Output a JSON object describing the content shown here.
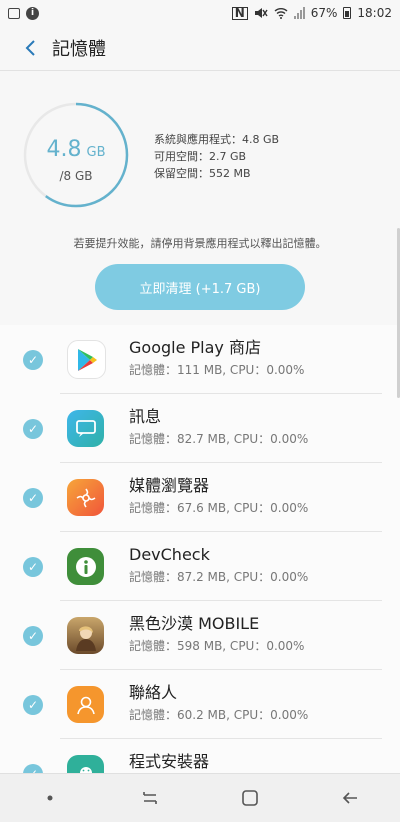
{
  "status_bar": {
    "battery": "67%",
    "time": "18:02",
    "nfc_label": "N"
  },
  "header": {
    "title": "記憶體",
    "back_icon": "chevron-left-icon"
  },
  "summary": {
    "used_value": "4.8",
    "used_unit": "GB",
    "total": "/8 GB",
    "used_fraction": 0.6,
    "stats": [
      "系統與應用程式：4.8 GB",
      "可用空間：2.7 GB",
      "保留空間：552 MB"
    ],
    "hint": "若要提升效能，請停用背景應用程式以釋出記憶體。",
    "clean_button": "立即清理 (+1.7 GB)"
  },
  "apps": [
    {
      "name": "Google Play 商店",
      "detail": "記憶體：111 MB, CPU：0.00%",
      "icon": "google-play-icon"
    },
    {
      "name": "訊息",
      "detail": "記憶體：82.7 MB, CPU：0.00%",
      "icon": "messages-icon"
    },
    {
      "name": "媒體瀏覽器",
      "detail": "記憶體：67.6 MB, CPU：0.00%",
      "icon": "media-browser-icon"
    },
    {
      "name": "DevCheck",
      "detail": "記憶體：87.2 MB, CPU：0.00%",
      "icon": "devcheck-icon"
    },
    {
      "name": "黑色沙漠 MOBILE",
      "detail": "記憶體：598 MB, CPU：0.00%",
      "icon": "black-desert-icon"
    },
    {
      "name": "聯絡人",
      "detail": "記憶體：60.2 MB, CPU：0.00%",
      "icon": "contacts-icon"
    },
    {
      "name": "程式安裝器",
      "detail": "",
      "icon": "android-installer-icon"
    }
  ],
  "colors": {
    "accent": "#64b2cd",
    "check": "#78c6dc",
    "button": "#7fcbe2"
  }
}
